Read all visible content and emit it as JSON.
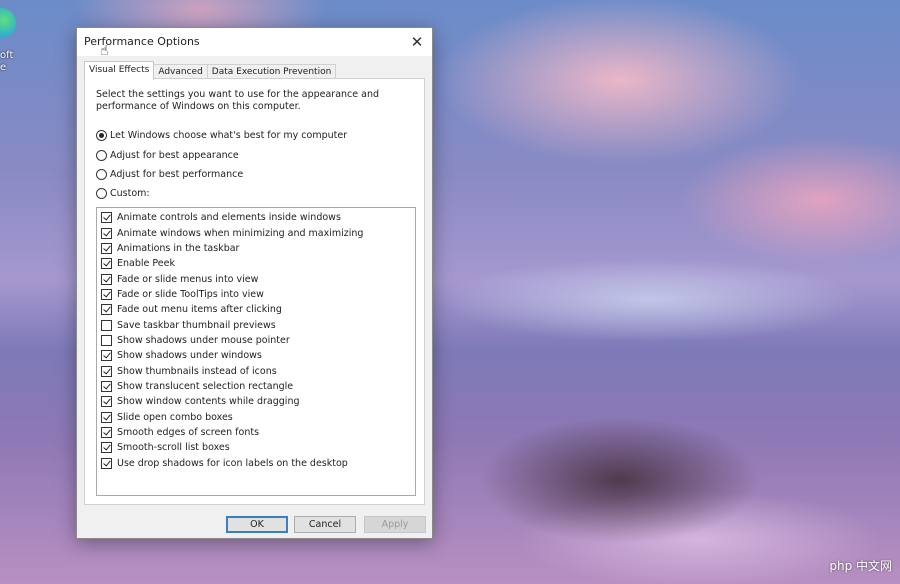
{
  "desktop": {
    "icon_label_line1": "oft",
    "icon_label_line2": "e",
    "watermark": "php 中文网"
  },
  "dialog": {
    "title": "Performance Options",
    "close_icon": "✕",
    "cursor_icon": "☝",
    "tabs": [
      {
        "label": "Visual Effects",
        "active": true
      },
      {
        "label": "Advanced",
        "active": false
      },
      {
        "label": "Data Execution Prevention",
        "active": false
      }
    ],
    "description": "Select the settings you want to use for the appearance and performance of Windows on this computer.",
    "radios": [
      {
        "label": "Let Windows choose what's best for my computer",
        "checked": true
      },
      {
        "label": "Adjust for best appearance",
        "checked": false
      },
      {
        "label": "Adjust for best performance",
        "checked": false
      },
      {
        "label": "Custom:",
        "checked": false
      }
    ],
    "options": [
      {
        "label": "Animate controls and elements inside windows",
        "checked": true
      },
      {
        "label": "Animate windows when minimizing and maximizing",
        "checked": true
      },
      {
        "label": "Animations in the taskbar",
        "checked": true
      },
      {
        "label": "Enable Peek",
        "checked": true
      },
      {
        "label": "Fade or slide menus into view",
        "checked": true
      },
      {
        "label": "Fade or slide ToolTips into view",
        "checked": true
      },
      {
        "label": "Fade out menu items after clicking",
        "checked": true
      },
      {
        "label": "Save taskbar thumbnail previews",
        "checked": false
      },
      {
        "label": "Show shadows under mouse pointer",
        "checked": false
      },
      {
        "label": "Show shadows under windows",
        "checked": true
      },
      {
        "label": "Show thumbnails instead of icons",
        "checked": true
      },
      {
        "label": "Show translucent selection rectangle",
        "checked": true
      },
      {
        "label": "Show window contents while dragging",
        "checked": true
      },
      {
        "label": "Slide open combo boxes",
        "checked": true
      },
      {
        "label": "Smooth edges of screen fonts",
        "checked": true
      },
      {
        "label": "Smooth-scroll list boxes",
        "checked": true
      },
      {
        "label": "Use drop shadows for icon labels on the desktop",
        "checked": true
      }
    ],
    "buttons": {
      "ok": "OK",
      "cancel": "Cancel",
      "apply": "Apply"
    }
  }
}
